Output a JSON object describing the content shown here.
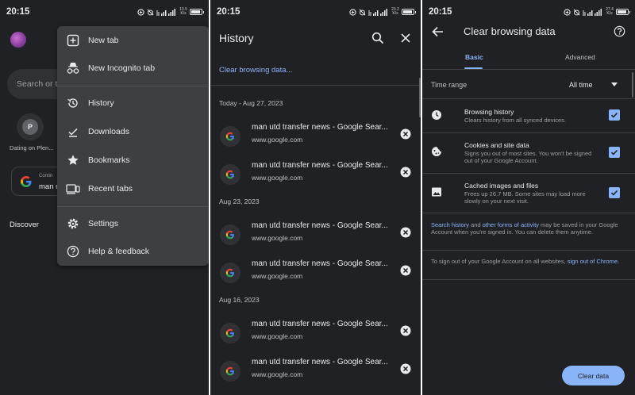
{
  "ui": {
    "accent": "#8ab4f8",
    "background": "#202124"
  },
  "panel_menu": {
    "status_time": "20:15",
    "status_speed": "13.5 K/s",
    "search_placeholder": "Search or ty",
    "tile": {
      "letter": "P",
      "label": "Dating on Plen..."
    },
    "continue_card": {
      "small": "Contin",
      "big": "man u"
    },
    "discover_label": "Discover",
    "menu_items": [
      {
        "label": "New tab",
        "icon": "new-tab-icon"
      },
      {
        "label": "New Incognito tab",
        "icon": "incognito-icon"
      },
      {
        "label": "History",
        "icon": "history-icon"
      },
      {
        "label": "Downloads",
        "icon": "downloads-icon"
      },
      {
        "label": "Bookmarks",
        "icon": "bookmark-star-icon"
      },
      {
        "label": "Recent tabs",
        "icon": "recent-tabs-icon"
      },
      {
        "label": "Settings",
        "icon": "settings-gear-icon"
      },
      {
        "label": "Help & feedback",
        "icon": "help-icon"
      }
    ]
  },
  "panel_history": {
    "status_time": "20:15",
    "status_speed": "23.2 K/s",
    "title": "History",
    "clear_link": "Clear browsing data...",
    "groups": [
      {
        "date": "Today - Aug 27, 2023",
        "entries": [
          {
            "title": "man utd transfer news - Google Sear...",
            "url": "www.google.com"
          },
          {
            "title": "man utd transfer news - Google Sear...",
            "url": "www.google.com"
          }
        ]
      },
      {
        "date": "Aug 23, 2023",
        "entries": [
          {
            "title": "man utd transfer news - Google Sear...",
            "url": "www.google.com"
          },
          {
            "title": "man utd transfer news - Google Sear...",
            "url": "www.google.com"
          }
        ]
      },
      {
        "date": "Aug 16, 2023",
        "entries": [
          {
            "title": "man utd transfer news - Google Sear...",
            "url": "www.google.com"
          },
          {
            "title": "man utd transfer news - Google Sear...",
            "url": "www.google.com"
          }
        ]
      }
    ]
  },
  "panel_clear": {
    "status_time": "20:15",
    "status_speed": "27.4 K/s",
    "title": "Clear browsing data",
    "tabs": [
      "Basic",
      "Advanced"
    ],
    "active_tab": "Basic",
    "time_range_label": "Time range",
    "time_range_value": "All time",
    "options": [
      {
        "title": "Browsing history",
        "desc": "Clears history from all synced devices.",
        "checked": true,
        "icon": "clock-icon"
      },
      {
        "title": "Cookies and site data",
        "desc": "Signs you out of most sites. You won't be signed out of your Google Account.",
        "checked": true,
        "icon": "cookie-icon"
      },
      {
        "title": "Cached images and files",
        "desc": "Frees up 26.7 MB. Some sites may load more slowly on your next visit.",
        "checked": true,
        "icon": "image-icon"
      }
    ],
    "note1": {
      "link1": "Search history",
      "text1": " and ",
      "link2": "other forms of activity",
      "text2": " may be saved in your Google Account when you're signed in. You can delete them anytime."
    },
    "note2": {
      "text": "To sign out of your Google Account on all websites, ",
      "link": "sign out of Chrome",
      "end": "."
    },
    "button_label": "Clear data"
  }
}
